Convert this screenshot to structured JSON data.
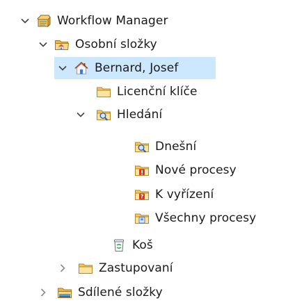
{
  "tree": {
    "root": {
      "label": "Workflow Manager",
      "icon": "workflow-manager-icon"
    },
    "personal": {
      "label": "Osobní složky",
      "icon": "personal-folders-icon"
    },
    "user": {
      "label": "Bernard, Josef",
      "icon": "user-home-icon"
    },
    "license_keys": {
      "label": "Licenční klíče",
      "icon": "folder-icon"
    },
    "search": {
      "label": "Hledání",
      "icon": "search-folder-icon"
    },
    "today": {
      "label": "Dnešní",
      "icon": "search-folder-icon"
    },
    "new_processes": {
      "label": "Nové procesy",
      "icon": "exclamation-folder-icon"
    },
    "to_handle": {
      "label": "K vyřízení",
      "icon": "question-folder-icon"
    },
    "all_processes": {
      "label": "Všechny procesy",
      "icon": "asterisk-folder-icon"
    },
    "trash": {
      "label": "Koš",
      "icon": "trash-icon"
    },
    "delegated": {
      "label": "Zastupovaní",
      "icon": "folder-icon"
    },
    "shared": {
      "label": "Sdílené složky",
      "icon": "shared-folders-icon"
    }
  }
}
